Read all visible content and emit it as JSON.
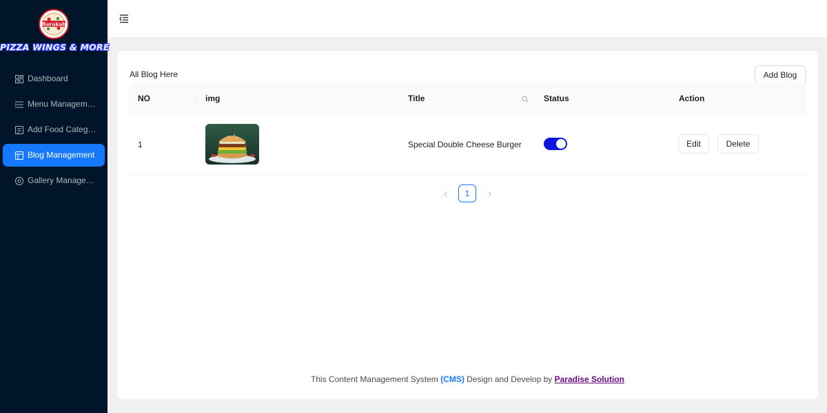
{
  "brand": {
    "emblem_text": "Barakah",
    "name": "PIZZA WINGS & MORE",
    "colors": {
      "outline": "#2b3cff",
      "emblem_red": "#d61f26"
    }
  },
  "sidebar": {
    "items": [
      {
        "label": "Dashboard",
        "icon": "dashboard-icon",
        "active": false
      },
      {
        "label": "Menu Management",
        "icon": "menu-list-icon",
        "active": false
      },
      {
        "label": "Add Food Category",
        "icon": "food-category-icon",
        "active": false
      },
      {
        "label": "Blog Management",
        "icon": "blog-icon",
        "active": true
      },
      {
        "label": "Gallery Management",
        "icon": "gallery-icon",
        "active": false
      }
    ],
    "colors": {
      "background": "#001529",
      "active": "#1677ff"
    }
  },
  "header": {
    "toggle_icon": "menu-fold-icon"
  },
  "page": {
    "title": "All Blog Here",
    "add_button": "Add Blog"
  },
  "table": {
    "columns": {
      "no": "NO",
      "img": "img",
      "title": "Title",
      "status": "Status",
      "action": "Action"
    },
    "rows": [
      {
        "no": "1",
        "image": "burger-image",
        "title": "Special Double Cheese Burger",
        "status_on": true,
        "edit": "Edit",
        "delete": "Delete"
      }
    ]
  },
  "pagination": {
    "current": "1",
    "prev_icon": "chevron-left-icon",
    "next_icon": "chevron-right-icon"
  },
  "footer": {
    "prefix": "This Content Management System",
    "cms": "(CMS)",
    "middle": "Design and Develop by",
    "link": "Paradise Solution"
  },
  "theme": {
    "toggle_on": "#0c16e0",
    "link_purple": "#6b0a84",
    "page_bg": "#f0f0f0"
  }
}
